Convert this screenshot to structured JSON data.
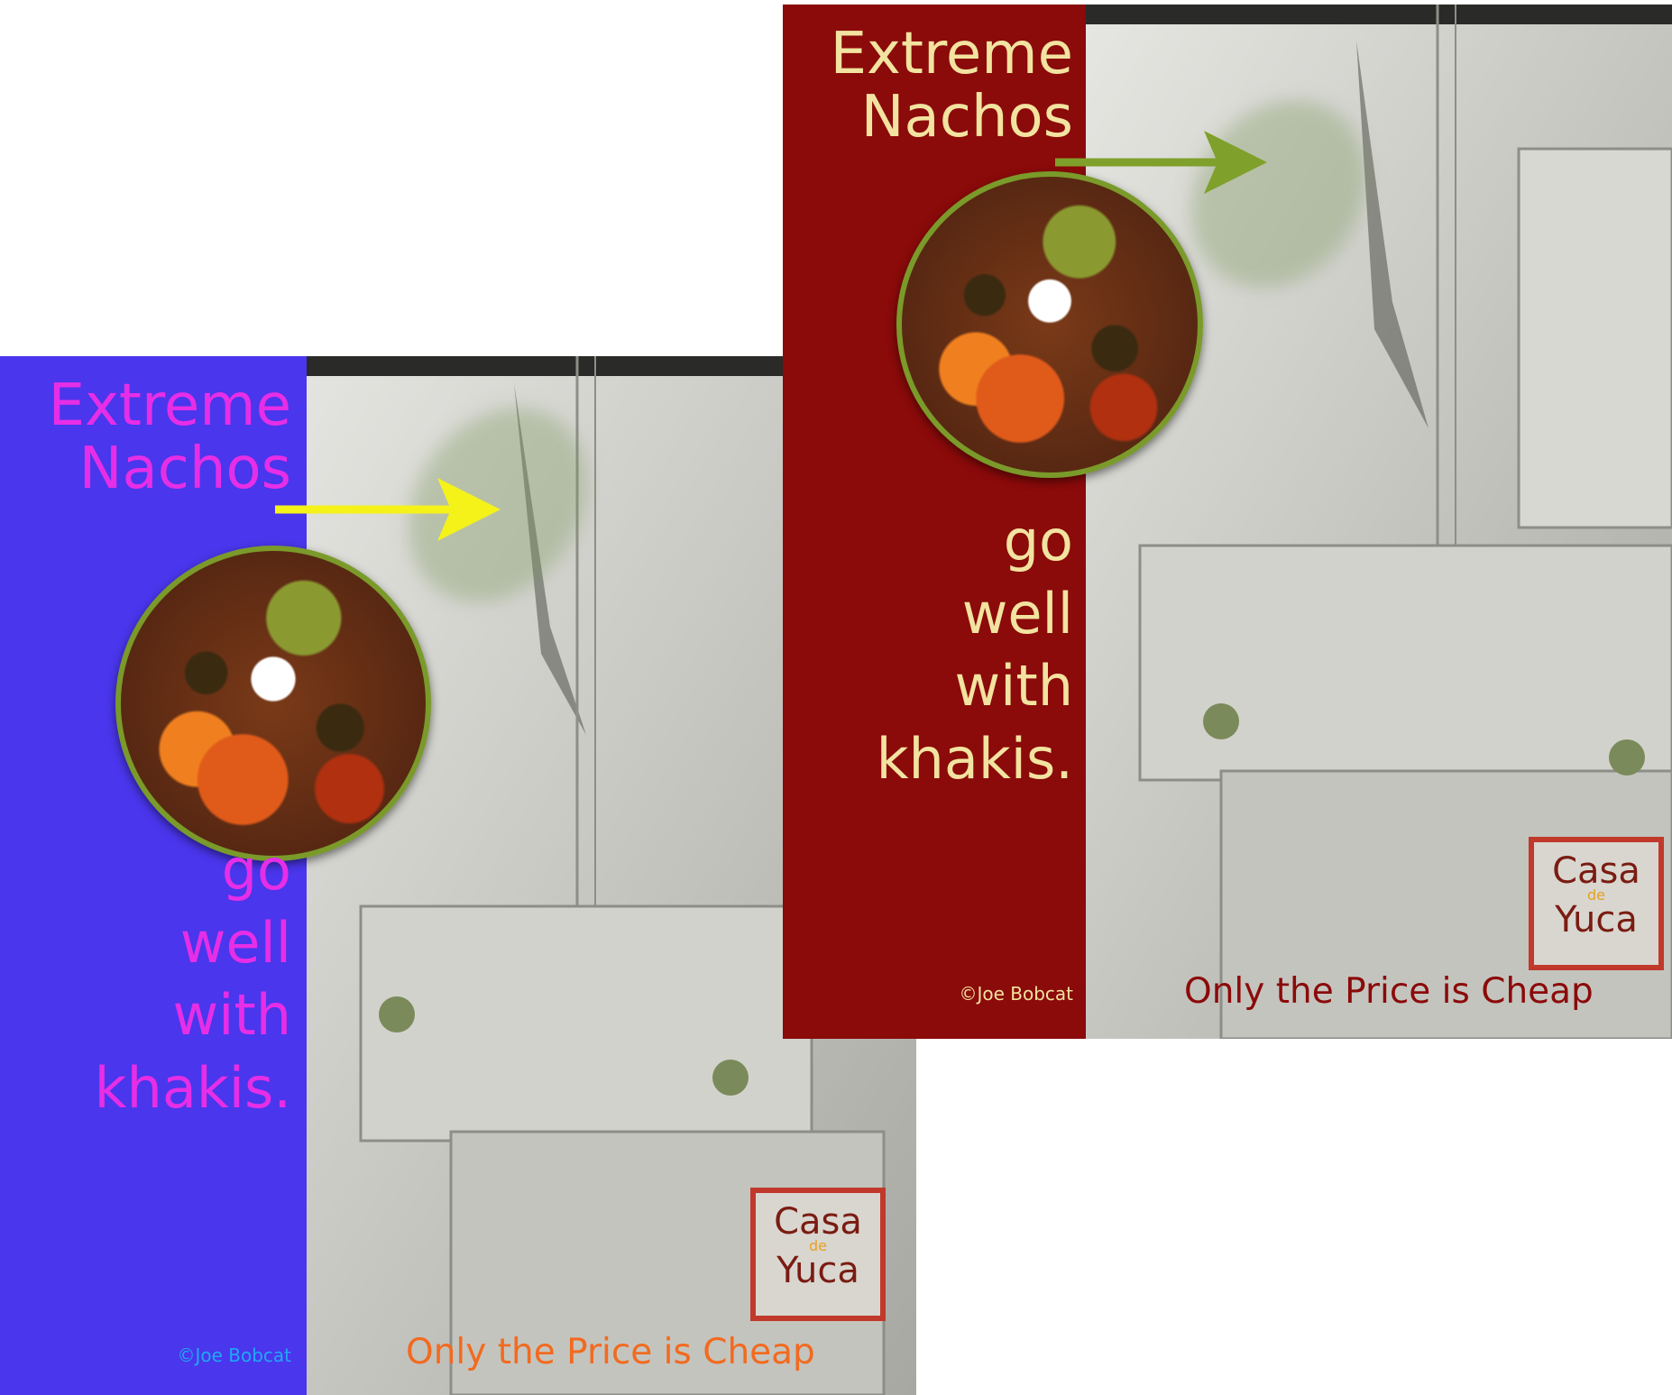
{
  "posters": [
    {
      "headline_line1": "Extreme",
      "headline_line2": "Nachos",
      "tagline": [
        "go",
        "well",
        "with",
        "khakis."
      ],
      "credit": "©Joe Bobcat",
      "slogan": "Only the Price is Cheap",
      "logo": {
        "line1": "Casa",
        "line2": "de",
        "line3": "Yuca"
      },
      "colors": {
        "panel": "#4a36ec",
        "headline": "#e62ee6",
        "credit": "#1fa9f5",
        "slogan": "#f26a1f",
        "arrow": "#f5f21a"
      }
    },
    {
      "headline_line1": "Extreme",
      "headline_line2": "Nachos",
      "tagline": [
        "go",
        "well",
        "with",
        "khakis."
      ],
      "credit": "©Joe Bobcat",
      "slogan": "Only the Price is Cheap",
      "logo": {
        "line1": "Casa",
        "line2": "de",
        "line3": "Yuca"
      },
      "colors": {
        "panel": "#8b0a0a",
        "headline": "#f2e3a0",
        "credit": "#f2e3a0",
        "slogan": "#8b0a0a",
        "arrow": "#7fa02a"
      }
    }
  ]
}
